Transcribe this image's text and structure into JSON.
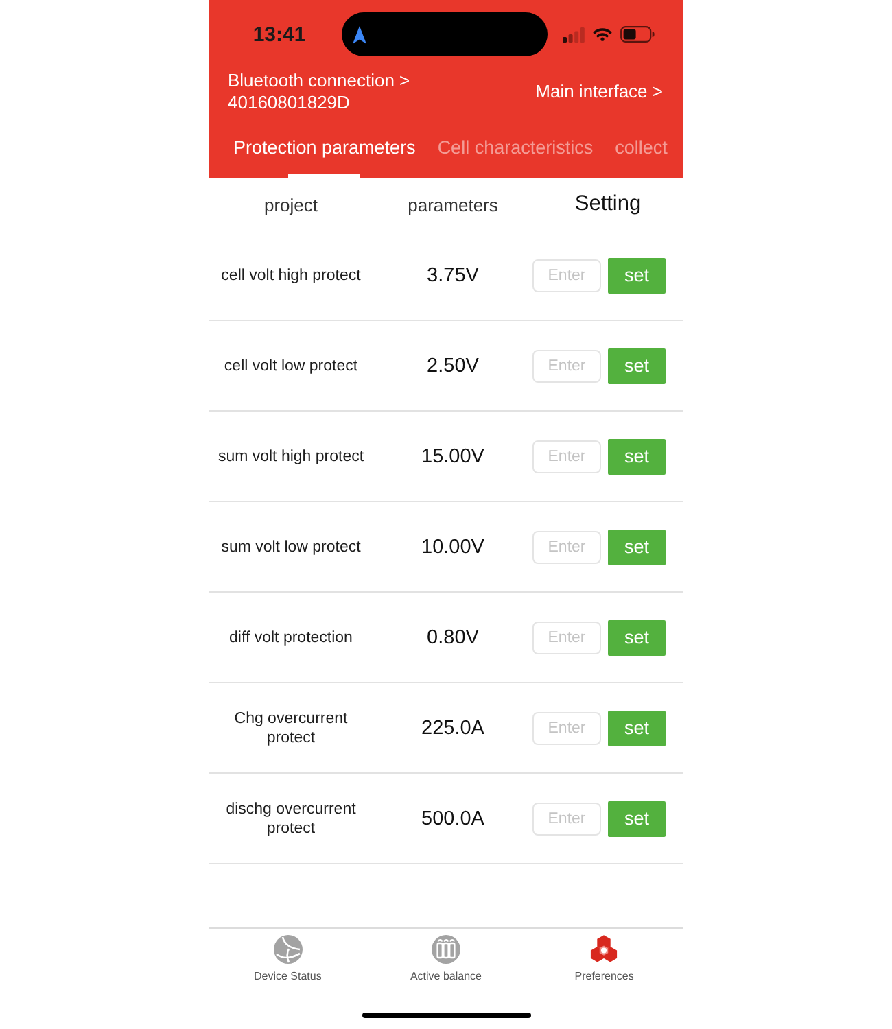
{
  "status_bar": {
    "time": "13:41"
  },
  "header": {
    "connection_link": "Bluetooth connection >",
    "device_id": "40160801829D",
    "main_interface_link": "Main interface >"
  },
  "tabs": [
    {
      "label": "Protection parameters",
      "selected": true
    },
    {
      "label": "Cell characteristics",
      "selected": false
    },
    {
      "label": "collect",
      "selected": false
    }
  ],
  "table": {
    "columns": [
      "project",
      "parameters",
      "Setting"
    ],
    "rows": [
      {
        "project": "cell volt high protect",
        "parameter": "3.75V",
        "placeholder": "Enter",
        "button": "set"
      },
      {
        "project": "cell volt low protect",
        "parameter": "2.50V",
        "placeholder": "Enter",
        "button": "set"
      },
      {
        "project": "sum volt high protect",
        "parameter": "15.00V",
        "placeholder": "Enter",
        "button": "set"
      },
      {
        "project": "sum volt low protect",
        "parameter": "10.00V",
        "placeholder": "Enter",
        "button": "set"
      },
      {
        "project": "diff volt protection",
        "parameter": "0.80V",
        "placeholder": "Enter",
        "button": "set"
      },
      {
        "project": "Chg overcurrent protect",
        "parameter": "225.0A",
        "placeholder": "Enter",
        "button": "set"
      },
      {
        "project": "dischg overcurrent protect",
        "parameter": "500.0A",
        "placeholder": "Enter",
        "button": "set"
      }
    ]
  },
  "bottom_nav": [
    {
      "kind": "globe",
      "label": "Device Status",
      "selected": false
    },
    {
      "kind": "cells",
      "label": "Active balance",
      "selected": false
    },
    {
      "kind": "hexagons",
      "label": "Preferences",
      "selected": true
    }
  ]
}
